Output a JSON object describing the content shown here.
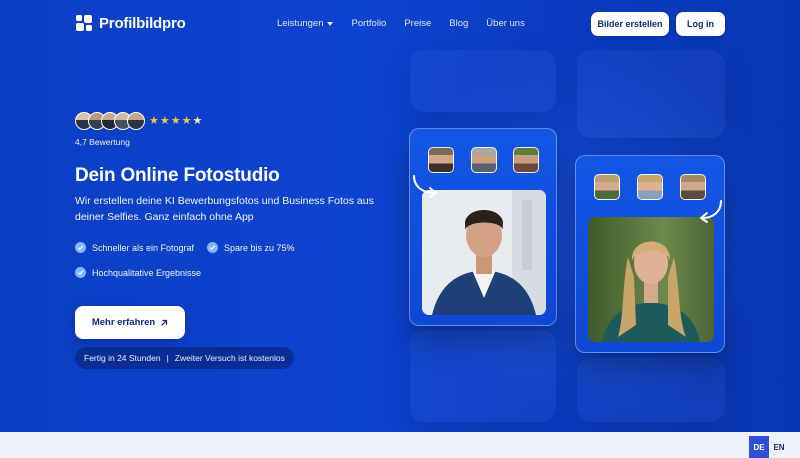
{
  "nav": {
    "brand": "Profilbildpro",
    "menu": [
      {
        "label": "Leistungen"
      },
      {
        "label": "Portfolio"
      },
      {
        "label": "Preise"
      },
      {
        "label": "Blog"
      },
      {
        "label": "Über uns"
      }
    ],
    "primary_button": "Bilder erstellen",
    "login_button": "Log in"
  },
  "hero": {
    "rating_stars": 5,
    "rating_text": "4,7 Bewertung",
    "title": "Dein Online Fotostudio",
    "subtitle": "Wir erstellen deine KI Bewerbungsfotos und Business Fotos aus deiner Selfies. Ganz einfach ohne App",
    "features": [
      "Schneller als ein Fotograf",
      "Spare bis zu 75%",
      "Hochqualitative Ergebnisse"
    ],
    "cta_label": "Mehr erfahren",
    "cta_icon": "arrow-up-right-icon",
    "info_left": "Fertig in 24 Stunden",
    "info_separator": "|",
    "info_right": "Zweiter Versuch ist kostenlos"
  },
  "languages": {
    "active": "DE",
    "other": "EN"
  },
  "colors": {
    "hero_background": "#0b3fc6",
    "card_background": "#1356e6",
    "star": "#f6c343",
    "check": "#7fb6ff",
    "footer": "#eef3fb",
    "lang_active": "#2f4fd6"
  }
}
